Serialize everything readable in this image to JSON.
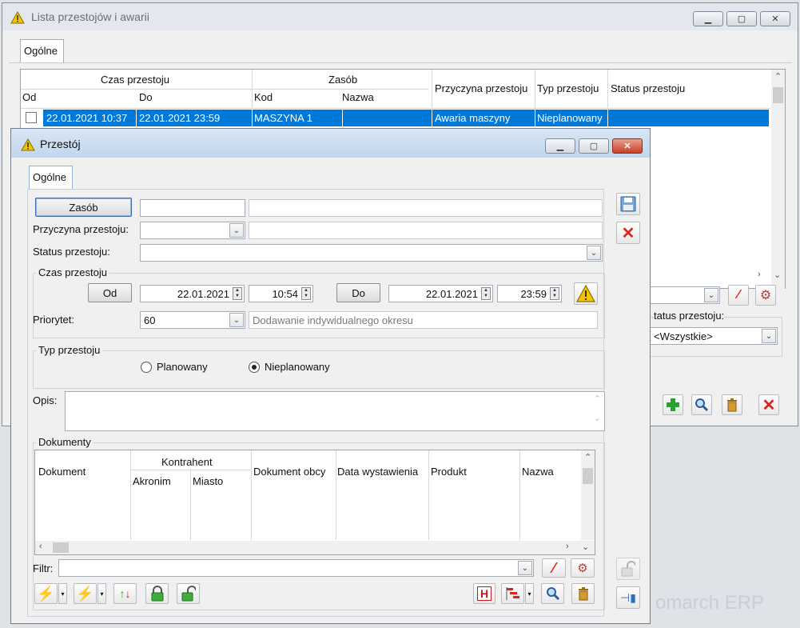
{
  "main_window": {
    "title": "Lista przestojów i awarii",
    "tab": "Ogólne",
    "grid": {
      "group_czas": "Czas przestoju",
      "group_zasob": "Zasób",
      "col_od": "Od",
      "col_do": "Do",
      "col_kod": "Kod",
      "col_nazwa": "Nazwa",
      "col_przyczyna": "Przyczyna przestoju",
      "col_typ": "Typ przestoju",
      "col_status": "Status przestoju",
      "rows": [
        {
          "od": "22.01.2021 10:37",
          "do": "22.01.2021 23:59",
          "kod": "MASZYNA 1",
          "nazwa": "",
          "przyczyna": "Awaria maszyny",
          "typ": "Nieplanowany",
          "status": ""
        }
      ]
    },
    "status_filter_label": "tatus przestoju:",
    "status_filter_value": "<Wszystkie>",
    "watermark": "omarch ERP"
  },
  "dialog": {
    "title": "Przestój",
    "tab": "Ogólne",
    "zasob_button": "Zasób",
    "zasob_code": "",
    "zasob_name": "",
    "przyczyna_label": "Przyczyna przestoju:",
    "przyczyna_value": "",
    "przyczyna_desc": "",
    "status_label": "Status przestoju:",
    "status_value": "",
    "czas_group": "Czas przestoju",
    "od_button": "Od",
    "od_date": "22.01.2021",
    "od_time": "10:54",
    "do_button": "Do",
    "do_date": "22.01.2021",
    "do_time": "23:59",
    "priorytet_label": "Priorytet:",
    "priorytet_value": "60",
    "priorytet_desc": "Dodawanie indywidualnego okresu",
    "typ_group": "Typ przestoju",
    "radio_planowany": "Planowany",
    "radio_nieplanowany": "Nieplanowany",
    "typ_selected": "Nieplanowany",
    "opis_label": "Opis:",
    "opis_value": "",
    "dokumenty_group": "Dokumenty",
    "doc_grid": {
      "col_dokument": "Dokument",
      "group_kontrahent": "Kontrahent",
      "col_akronim": "Akronim",
      "col_miasto": "Miasto",
      "col_dok_obcy": "Dokument obcy",
      "col_data": "Data wystawienia",
      "col_produkt": "Produkt",
      "col_nazwa": "Nazwa"
    },
    "filtr_label": "Filtr:",
    "filtr_value": ""
  },
  "icons": {
    "warning": "warning-icon",
    "save": "save-icon",
    "close": "close-icon",
    "lock": "lock-icon",
    "unlock": "unlock-icon",
    "pin": "pin-icon",
    "add": "add-icon",
    "search": "magnifier-icon",
    "delete": "trash-icon",
    "history": "history-icon",
    "gantt": "gantt-icon",
    "clear_filter": "clear-filter-icon",
    "filter_settings": "filter-settings-icon",
    "sort": "sort-icon",
    "generate": "generate-icon"
  },
  "colors": {
    "selection": "#0078d7",
    "warning": "#f5c400",
    "close_red": "#d9261c",
    "add_green": "#27a22e"
  }
}
